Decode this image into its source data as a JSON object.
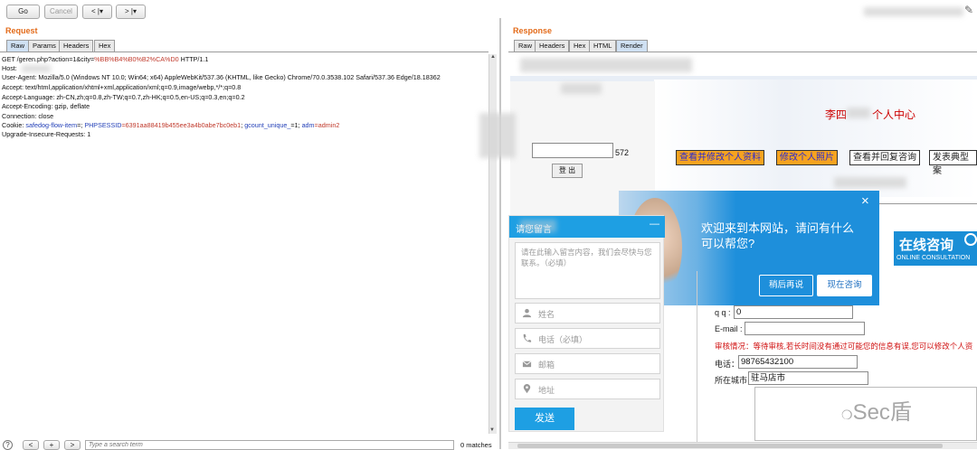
{
  "toolbar": {
    "go": "Go",
    "cancel": "Cancel",
    "back": "<  |▾",
    "forward": ">  |▾"
  },
  "request": {
    "title": "Request",
    "tabs": [
      "Raw",
      "Params",
      "Headers",
      "Hex"
    ],
    "line1_pre": "GET /geren.php?action=1&city=",
    "line1_val": "%BB%B4%B0%B2%CA%D0",
    "line1_post": " HTTP/1.1",
    "host": "Host:",
    "user_agent": "User-Agent: Mozilla/5.0 (Windows NT 10.0; Win64; x64) AppleWebKit/537.36 (KHTML, like Gecko) Chrome/70.0.3538.102 Safari/537.36 Edge/18.18362",
    "accept": "Accept: text/html,application/xhtml+xml,application/xml;q=0.9,image/webp,*/*;q=0.8",
    "accept_language": "Accept-Language: zh-CN,zh;q=0.8,zh-TW;q=0.7,zh-HK;q=0.5,en-US;q=0.3,en;q=0.2",
    "accept_encoding": "Accept-Encoding: gzip, deflate",
    "connection": "Connection: close",
    "cookie_label": "Cookie: ",
    "cookie_k1": "safedog-flow-item",
    "cookie_v1": "=; ",
    "cookie_k2": "PHPSESSID",
    "cookie_v2": "=6391aa88419b455ee3a4b0abe7bc0eb1",
    "cookie_sep2": "; ",
    "cookie_k3": "gcount_unique_",
    "cookie_v3": "=1; ",
    "cookie_k4": "adm",
    "cookie_v4": "=admin2",
    "upgrade": "Upgrade-Insecure-Requests: 1"
  },
  "search": {
    "help": "?",
    "prev": "<",
    "add": "+",
    "next": ">",
    "placeholder": "Type a search term",
    "matches": "0 matches"
  },
  "response": {
    "title": "Response",
    "tabs": [
      "Raw",
      "Headers",
      "Hex",
      "HTML",
      "Render"
    ],
    "page_title_pre": "李四",
    "page_title_post": "个人中心",
    "nav": [
      "查看并修改个人资料",
      "修改个人照片",
      "查看并回复咨询",
      "发表典型案"
    ],
    "left_text1": "572",
    "left_text2": "登 出",
    "popup": {
      "text": "欢迎来到本网站，请问有什么可以帮您?",
      "later": "稍后再说",
      "consult": "现在咨询",
      "close": "×"
    },
    "online": {
      "title": "在线咨询",
      "subtitle": "ONLINE CONSULTATION"
    },
    "form": {
      "qq_label": "q q :",
      "qq_value": "0",
      "email_label": "E-mail :",
      "email_value": "",
      "notice": "审核情况：等待审核,若长时间没有通过可能您的信息有误,您可以修改个人资",
      "phone_label": "电话：",
      "phone_value": "98765432100",
      "city_label": "所在城市",
      "city_value": "驻马店市"
    },
    "chat": {
      "header": "请您留言",
      "minimize": "—",
      "textarea_placeholder": "请在此输入留言内容，我们会尽快与您联系。（必填）",
      "name": "姓名",
      "phone": "电话（必填）",
      "email": "邮箱",
      "address": "地址",
      "send": "发送"
    },
    "watermark": "Sec盾"
  }
}
